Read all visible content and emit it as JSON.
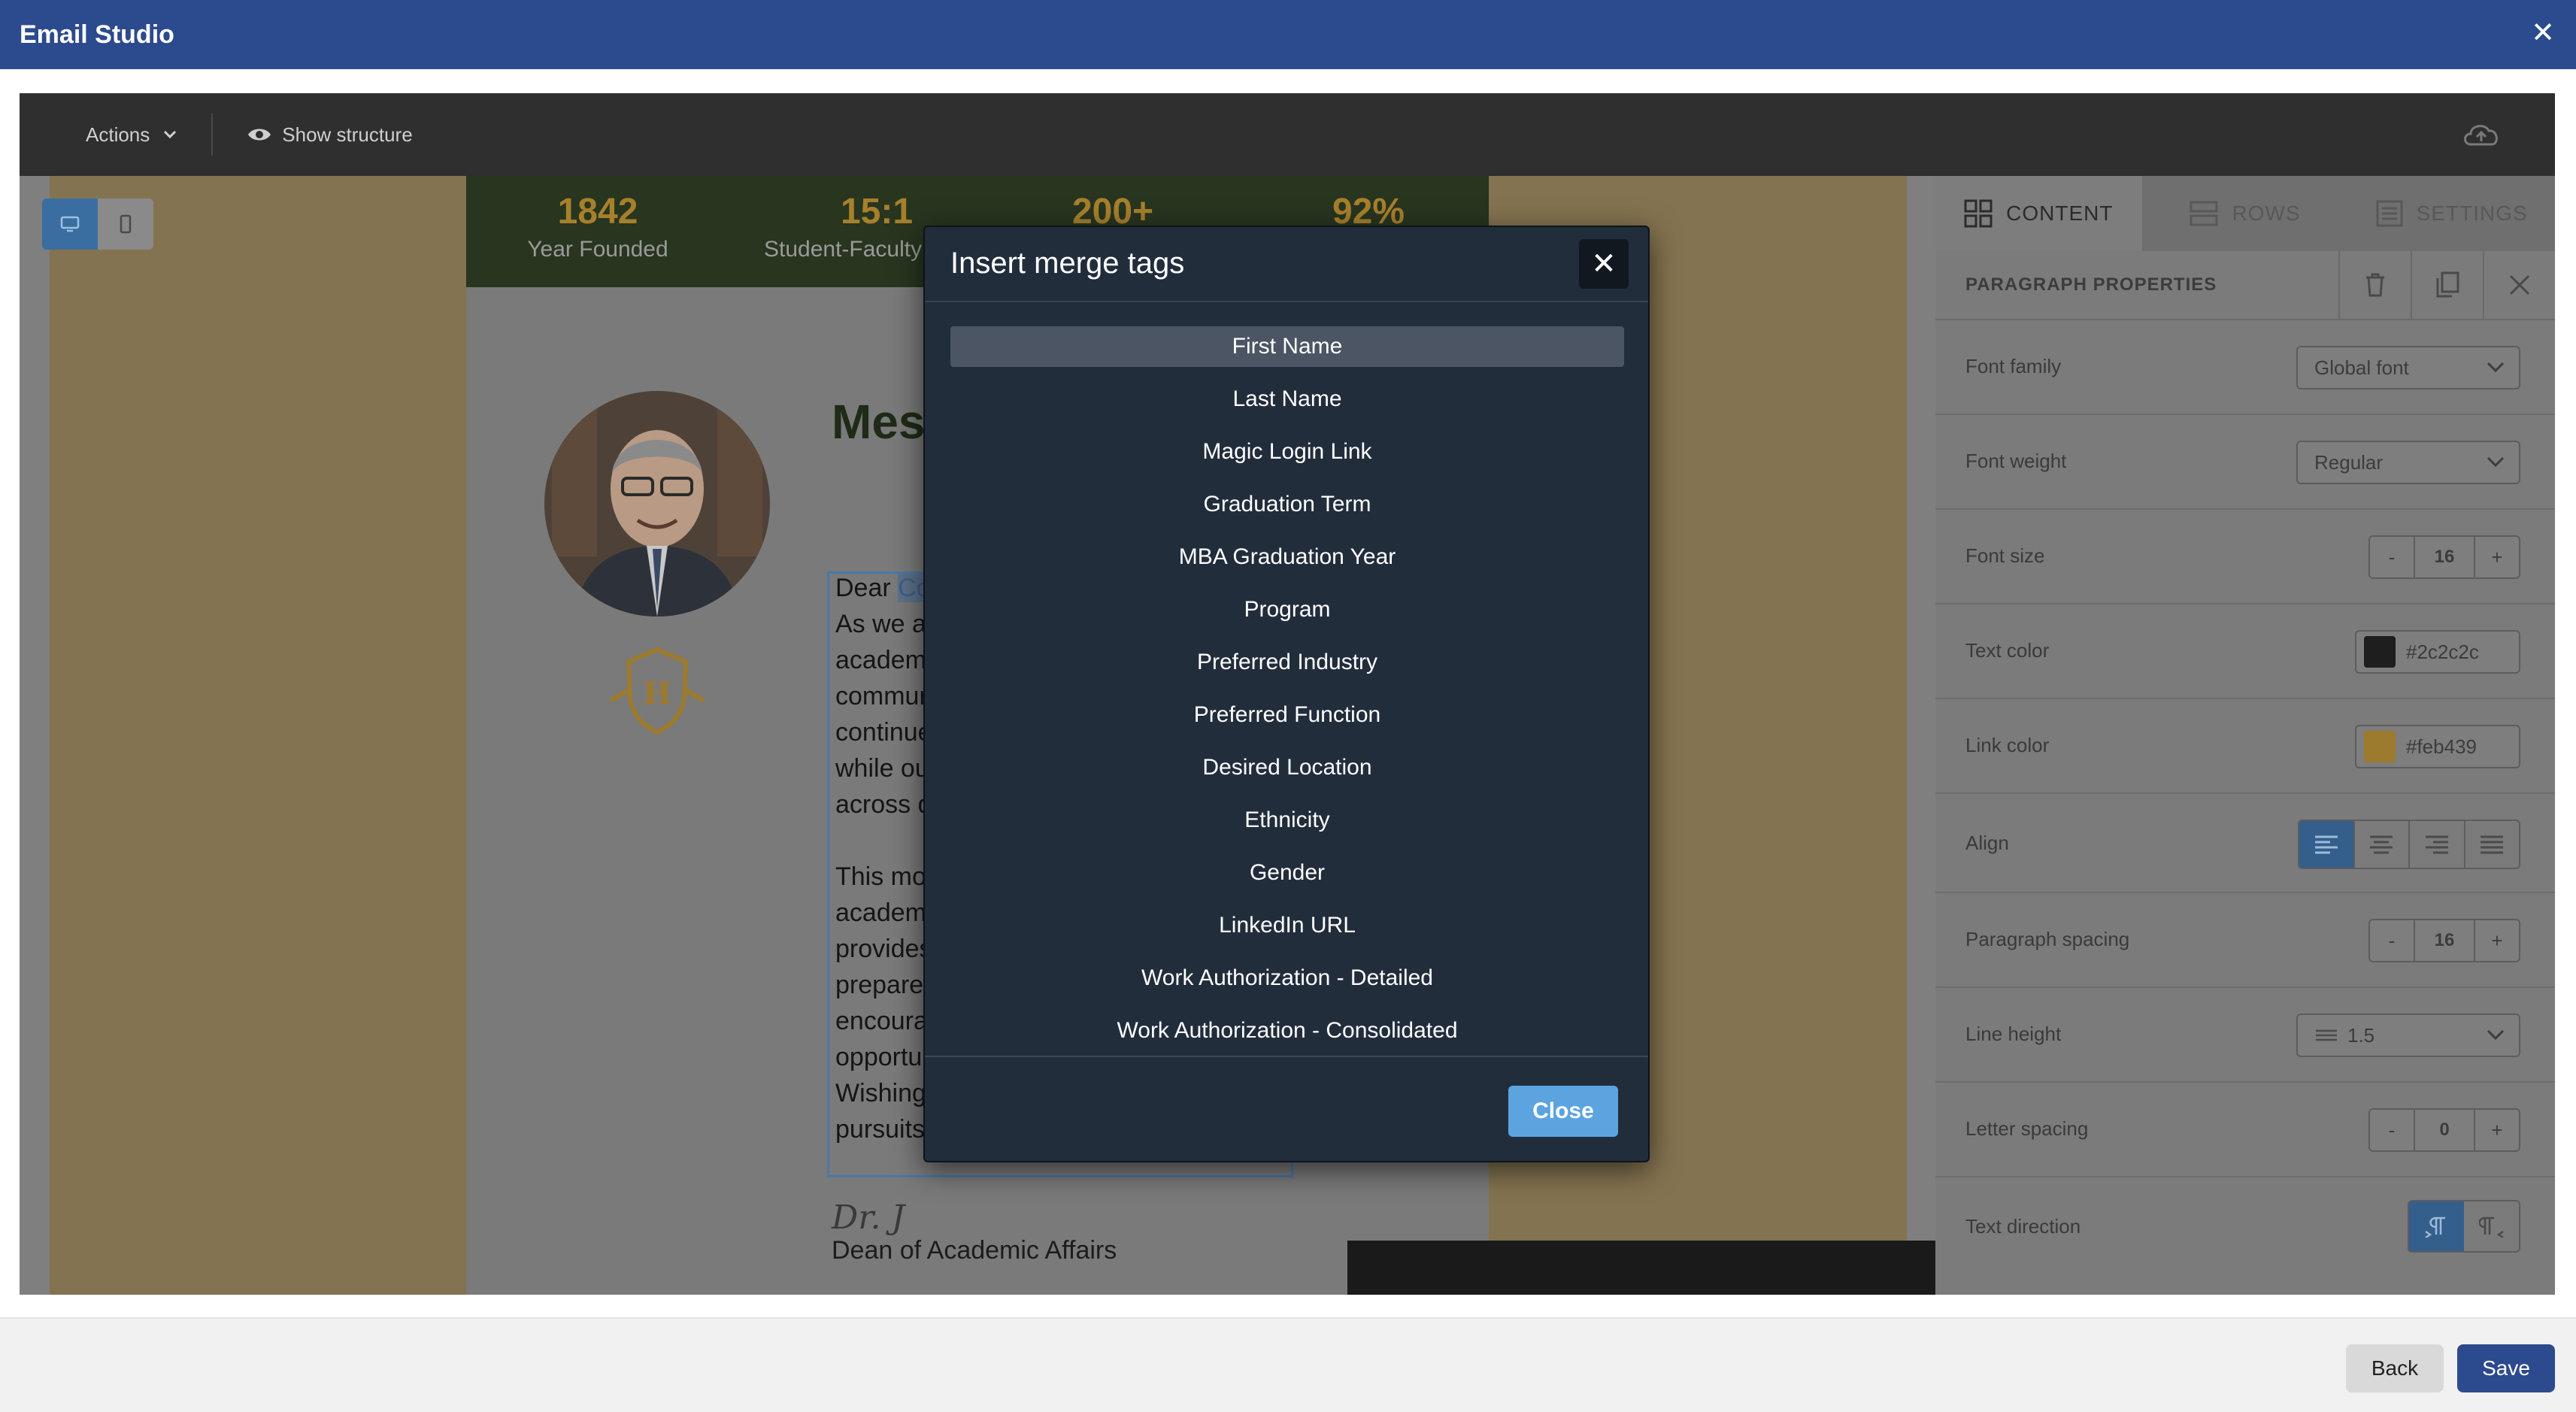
{
  "window": {
    "title": "Email Studio"
  },
  "toolbar": {
    "actions_label": "Actions",
    "structure_label": "Show structure"
  },
  "email": {
    "stats": [
      {
        "value": "1842",
        "label": "Year Founded"
      },
      {
        "value": "15:1",
        "label": "Student-Faculty Ra"
      },
      {
        "value": "200+",
        "label": ""
      },
      {
        "value": "92%",
        "label": ""
      }
    ],
    "heading": "Mes",
    "paragraph_lines": [
      "Dear ",
      "As we ap",
      "academi",
      "commur",
      "continue",
      "while ou",
      "across d",
      "This mor",
      "academi",
      "provides",
      "prepare",
      "encoura",
      "opportu",
      "Wishing",
      "pursuits"
    ],
    "merge_tag_fragment": "Co",
    "signature": "Dr. J",
    "signature_title": "Dean of Academic Affairs"
  },
  "panel": {
    "tabs": [
      {
        "label": "CONTENT",
        "icon": "grid-icon",
        "active": true
      },
      {
        "label": "ROWS",
        "icon": "rows-icon",
        "active": false
      },
      {
        "label": "SETTINGS",
        "icon": "settings-icon",
        "active": false
      }
    ],
    "section_title": "PARAGRAPH PROPERTIES",
    "font_family": {
      "label": "Font family",
      "value": "Global font"
    },
    "font_weight": {
      "label": "Font weight",
      "value": "Regular"
    },
    "font_size": {
      "label": "Font size",
      "value": "16",
      "minus": "-",
      "plus": "+"
    },
    "text_color": {
      "label": "Text color",
      "value": "#2c2c2c"
    },
    "link_color": {
      "label": "Link color",
      "value": "#feb439"
    },
    "align": {
      "label": "Align",
      "selected": "left"
    },
    "paragraph_spacing": {
      "label": "Paragraph spacing",
      "value": "16",
      "minus": "-",
      "plus": "+"
    },
    "line_height": {
      "label": "Line height",
      "value": "1.5"
    },
    "letter_spacing": {
      "label": "Letter spacing",
      "value": "0",
      "minus": "-",
      "plus": "+"
    },
    "text_direction": {
      "label": "Text direction",
      "selected": "ltr"
    }
  },
  "modal": {
    "title": "Insert merge tags",
    "tags": [
      "First Name",
      "Last Name",
      "Magic Login Link",
      "Graduation Term",
      "MBA Graduation Year",
      "Program",
      "Preferred Industry",
      "Preferred Function",
      "Desired Location",
      "Ethnicity",
      "Gender",
      "LinkedIn URL",
      "Work Authorization - Detailed",
      "Work Authorization - Consolidated"
    ],
    "selected_index": 0,
    "close_label": "Close"
  },
  "footer": {
    "back_label": "Back",
    "save_label": "Save"
  },
  "colors": {
    "brand": "#2c4a8e",
    "accent": "#5ba4e0",
    "modal_bg": "#222d3c",
    "gold": "#a7802c"
  }
}
